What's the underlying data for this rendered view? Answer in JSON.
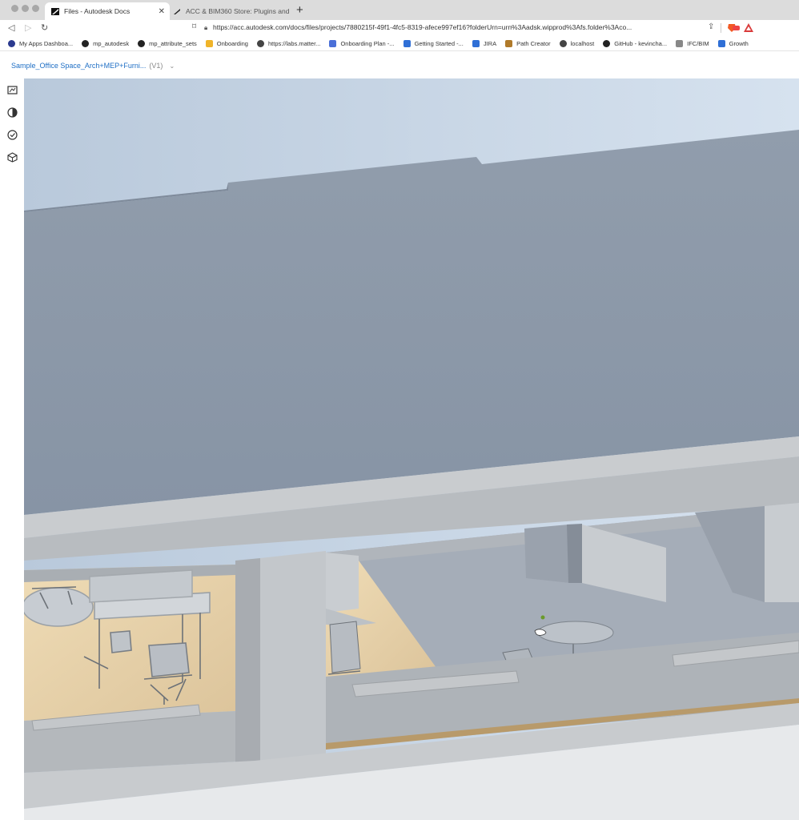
{
  "browser": {
    "tabs": [
      {
        "title": "Files - Autodesk Docs",
        "active": true
      },
      {
        "title": "ACC & BIM360 Store: Plugins and",
        "active": false
      }
    ],
    "new_tab_label": "+",
    "url": "https://acc.autodesk.com/docs/files/projects/7880215f-49f1-4fc5-8319-afece997ef16?folderUrn=urn%3Aadsk.wipprod%3Afs.folder%3Aco...",
    "bookmarks": [
      {
        "label": "My Apps Dashboa...",
        "icon": "circle-icon",
        "color": "#2b3a8f"
      },
      {
        "label": "mp_autodesk",
        "icon": "github-icon",
        "color": "#222"
      },
      {
        "label": "mp_attribute_sets",
        "icon": "github-icon",
        "color": "#222"
      },
      {
        "label": "Onboarding",
        "icon": "folder-icon",
        "color": "#f0b429"
      },
      {
        "label": "https://labs.matter...",
        "icon": "globe-icon",
        "color": "#444"
      },
      {
        "label": "Onboarding Plan -...",
        "icon": "doc-icon",
        "color": "#4a6fd8"
      },
      {
        "label": "Getting Started -...",
        "icon": "confluence-icon",
        "color": "#2f6fd6"
      },
      {
        "label": "JIRA",
        "icon": "jira-icon",
        "color": "#2f6fd6"
      },
      {
        "label": "Path Creator",
        "icon": "path-icon",
        "color": "#b07a2a"
      },
      {
        "label": "localhost",
        "icon": "globe-icon",
        "color": "#444"
      },
      {
        "label": "GitHub - kevincha...",
        "icon": "github-icon",
        "color": "#222"
      },
      {
        "label": "IFC/BIM",
        "icon": "ifc-icon",
        "color": "#888"
      },
      {
        "label": "Growth",
        "icon": "confluence-icon",
        "color": "#2f6fd6"
      }
    ]
  },
  "viewer": {
    "document_title": "Sample_Office Space_Arch+MEP+Furni...",
    "version": "(V1)",
    "side_icons": [
      "sheets-icon",
      "appearance-icon",
      "checkmark-icon",
      "model-browser-icon"
    ]
  },
  "colors": {
    "accent": "#1f6fc5",
    "sky": "#c2d2e4",
    "roof": "#8e9aaa",
    "floor_wood": "#e6d2ad"
  }
}
